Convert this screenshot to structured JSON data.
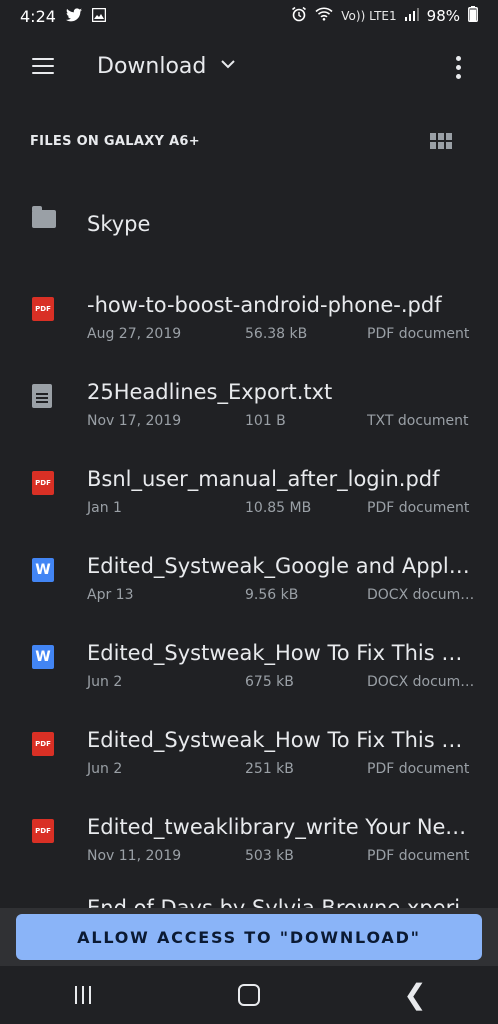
{
  "status_bar": {
    "time": "4:24",
    "battery": "98%",
    "network_text": "Vo)) LTE1"
  },
  "app_bar": {
    "title": "Download",
    "menu_icon": "hamburger-menu-icon",
    "dropdown_icon": "chevron-down-icon",
    "more_icon": "more-vert-icon"
  },
  "section": {
    "title": "FILES ON GALAXY A6+",
    "view_icon": "grid-view-icon"
  },
  "files": [
    {
      "name": "Skype",
      "kind": "folder"
    },
    {
      "name": "-how-to-boost-android-phone-.pdf",
      "date": "Aug 27, 2019",
      "size": "56.38 kB",
      "type": "PDF document",
      "kind": "pdf"
    },
    {
      "name": "25Headlines_Export.txt",
      "date": "Nov 17, 2019",
      "size": "101 B",
      "type": "TXT document",
      "kind": "txt"
    },
    {
      "name": "Bsnl_user_manual_after_login.pdf",
      "date": "Jan 1",
      "size": "10.85 MB",
      "type": "PDF document",
      "kind": "pdf"
    },
    {
      "name": "Edited_Systweak_Google and Appl…",
      "date": "Apr 13",
      "size": "9.56 kB",
      "type": "DOCX docum…",
      "kind": "docx"
    },
    {
      "name": "Edited_Systweak_How To Fix This …",
      "date": "Jun 2",
      "size": "675 kB",
      "type": "DOCX docum…",
      "kind": "docx"
    },
    {
      "name": "Edited_Systweak_How To Fix This …",
      "date": "Jun 2",
      "size": "251 kB",
      "type": "PDF document",
      "kind": "pdf"
    },
    {
      "name": "Edited_tweaklibrary_write Your Nex…",
      "date": "Nov 11, 2019",
      "size": "503 kB",
      "type": "PDF document",
      "kind": "pdf"
    }
  ],
  "partial_file_name": "End of Days by Sylvia Browne xperi",
  "icon_labels": {
    "pdf": "PDF",
    "docx": "W"
  },
  "access_button_label": "ALLOW ACCESS TO \"DOWNLOAD\"",
  "nav": {
    "recent_icon": "recent-apps-icon",
    "home_icon": "home-icon",
    "back_icon": "back-icon",
    "back_glyph": "❮"
  }
}
